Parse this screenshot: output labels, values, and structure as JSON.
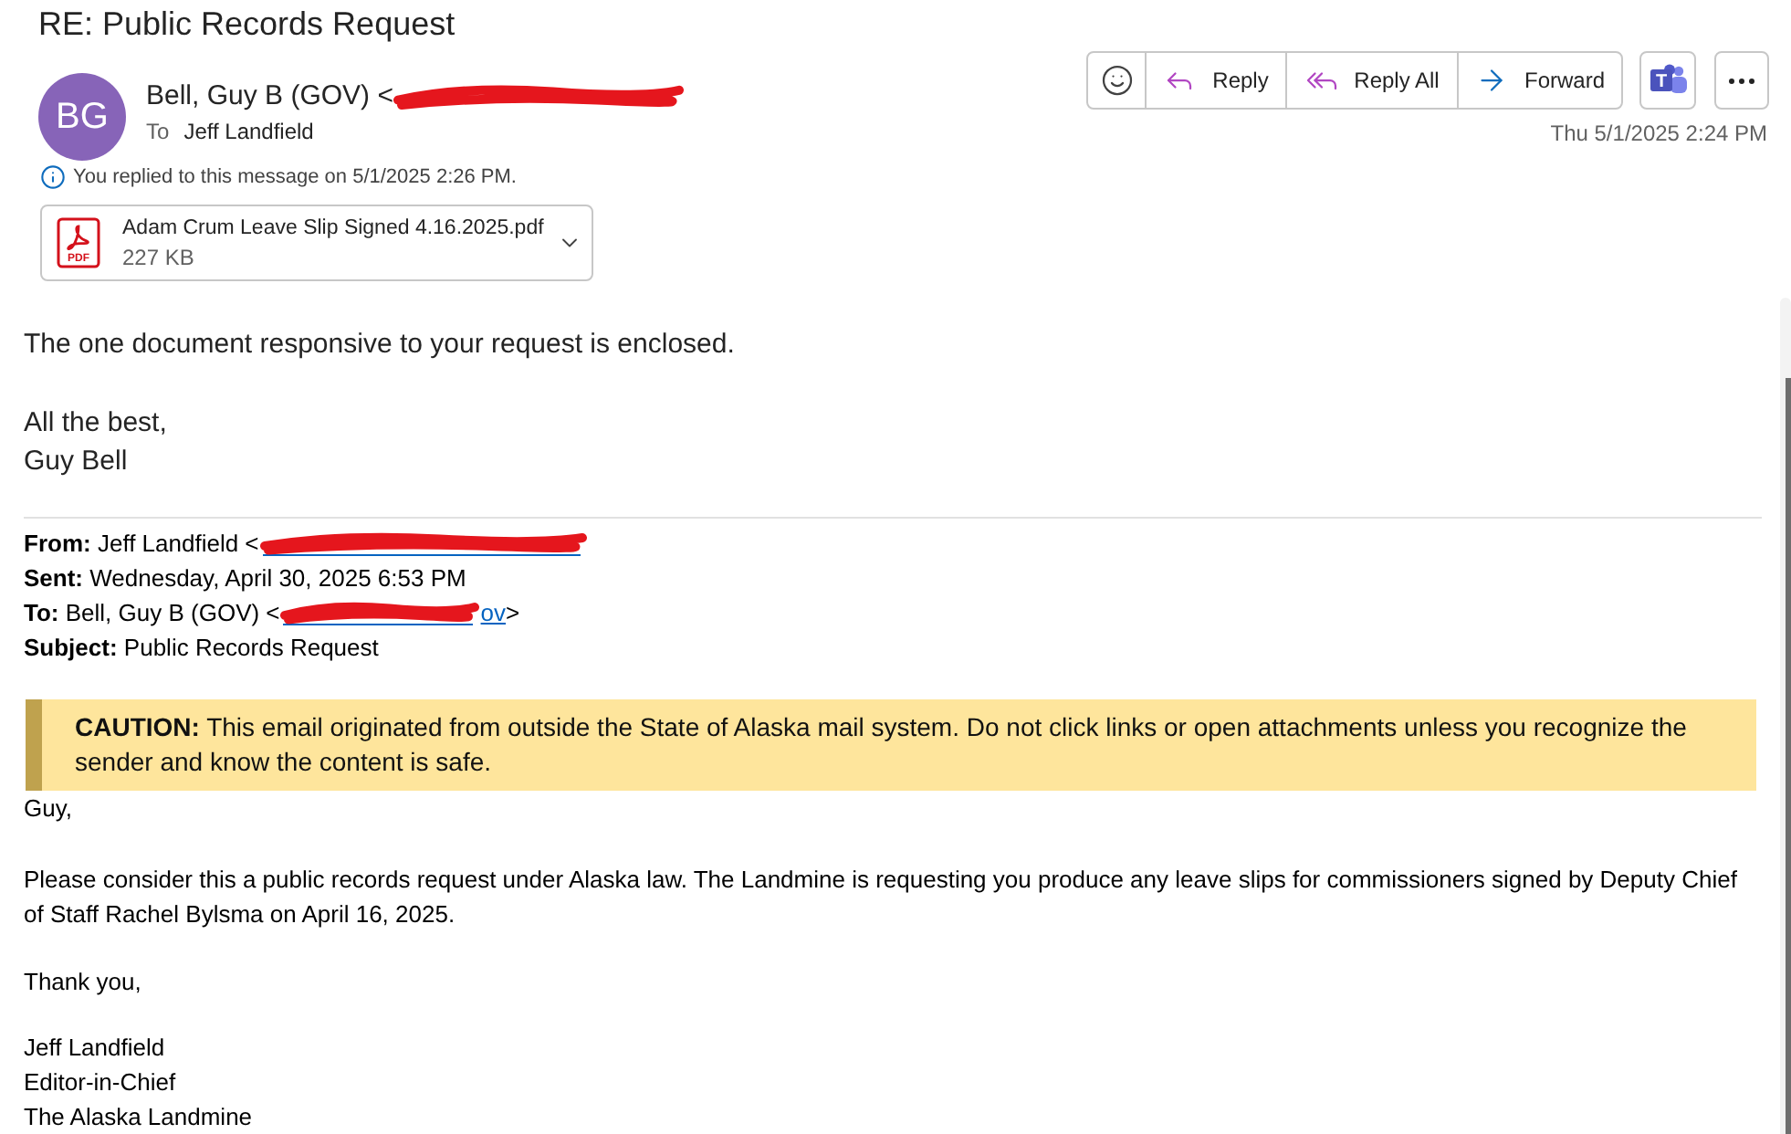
{
  "message": {
    "subject": "RE: Public Records Request",
    "sender": {
      "initials": "BG",
      "name": "Bell, Guy B (GOV) <",
      "redacted": true
    },
    "recipient_label": "To",
    "recipient": "Jeff Landfield",
    "reply_notice": "You replied to this message on 5/1/2025 2:26 PM.",
    "attachment": {
      "file_type": "PDF",
      "name": "Adam Crum Leave Slip Signed 4.16.2025.pdf",
      "size": "227 KB"
    },
    "actions": [
      {
        "kind": "emoji"
      },
      {
        "kind": "reply",
        "label": "Reply"
      },
      {
        "kind": "reply_all",
        "label": "Reply All"
      },
      {
        "kind": "forward",
        "label": "Forward"
      }
    ],
    "extra_buttons": [
      {
        "kind": "teams",
        "glyph": "T"
      },
      {
        "kind": "more"
      }
    ],
    "date": "Thu 5/1/2025 2:24 PM"
  },
  "body": {
    "paragraphs": [
      "The one document responsive to your request is enclosed."
    ],
    "closing": [
      "All the best,",
      "Guy Bell"
    ]
  },
  "quoted": {
    "headers": [
      {
        "label": "From:",
        "value": "Jeff Landfield <",
        "redacted": true
      },
      {
        "label": "Sent:",
        "value": "Wednesday, April 30, 2025 6:53 PM",
        "redacted": false
      },
      {
        "label": "To:",
        "value": "Bell, Guy B (GOV) <",
        "redacted": true,
        "link_tail": "ov",
        "tail": ">"
      },
      {
        "label": "Subject:",
        "value": "Public Records Request",
        "redacted": false
      }
    ],
    "caution": "**CAUTION:** This email originated from outside the State of Alaska mail system. Do not click links or open attachments unless you recognize the sender and know the content is safe.",
    "greeting": "Guy,",
    "paragraphs": [
      "Please consider this a public records request under Alaska law. The Landmine is requesting you produce any leave slips for commissioners signed by Deputy Chief of Staff Rachel Bylsma on April 16, 2025."
    ],
    "thanks": "Thank you,",
    "signature": [
      "Jeff Landfield",
      "Editor-in-Chief",
      "The Alaska Landmine"
    ]
  }
}
